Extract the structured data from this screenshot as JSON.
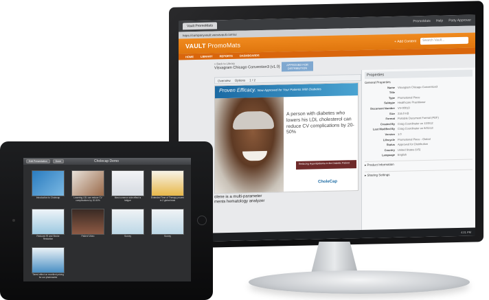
{
  "monitor": {
    "browser_tab": "Vault PromoMats",
    "browser_right": [
      "PromoMats",
      "Help",
      "Patty Approver"
    ],
    "url": "https://companyvault.veevavault.com/ui",
    "app_logo_bold": "VAULT",
    "app_logo_light": "PromoMats",
    "add_content": "+ Add Content",
    "search_placeholder": "Search Vault...",
    "nav": [
      "HOME",
      "LIBRARY",
      "REPORTS",
      "DASHBOARDS"
    ],
    "crumb": "« Back to Library",
    "doc_title": "Visvagram Chicago Convention3 (v1.0)",
    "approve_label": "APPROVED FOR DISTRIBUTION",
    "toolbar": [
      "Overview",
      "Options",
      "1 / 2"
    ],
    "slide": {
      "banner": "Proven Efficacy.",
      "banner_small": "Now Approved for Your Patients With Diabetes",
      "quote": "A person with diabetes who lowers his LDL cholesterol can reduce CV complications by 20-50%",
      "ad": "Reducing Hyperlipidemia in the Diabetic Patient",
      "logo": "CholeCap"
    },
    "footer_line1": "olene is a multi-parameter",
    "footer_line2": "ments hematology analyzer",
    "props": {
      "header": "Properties",
      "sub": "General Properties",
      "rows": [
        {
          "k": "Name",
          "v": "Visvagram Chicago Convention3"
        },
        {
          "k": "Title",
          "v": ""
        },
        {
          "k": "Type",
          "v": "Promotional Piece"
        },
        {
          "k": "Subtype",
          "v": "Healthcare Practitioner"
        },
        {
          "k": "Document Number",
          "v": "VV-00019"
        },
        {
          "k": "Size",
          "v": "216.0 KB"
        },
        {
          "k": "Format",
          "v": "Portable Document Format (PDF)"
        },
        {
          "k": "Created By",
          "v": "Craig Coordinator on 12/3/12"
        },
        {
          "k": "Last Modified By",
          "v": "Craig Coordinator on 6/21/13"
        },
        {
          "k": "Version",
          "v": "1.0"
        },
        {
          "k": "Lifecycle",
          "v": "Promotional Piece - Global"
        },
        {
          "k": "Status",
          "v": "Approved for Distribution"
        },
        {
          "k": "Country",
          "v": "United States (US)"
        },
        {
          "k": "Language",
          "v": "English"
        }
      ],
      "section1": "▸ Product Information",
      "section2": "▸ Sharing Settings"
    },
    "clock": "4:21 PM"
  },
  "ipad": {
    "btn_left": "Edit Presentation",
    "btn_right": "Done",
    "title": "Cholecap Demo",
    "tiles": [
      {
        "caption": "Introduction to Cholecap"
      },
      {
        "caption": "Lowering LDL can reduce CV complications by 20-50%"
      },
      {
        "caption": "Most common side effect is fatigue"
      },
      {
        "caption": "Extended Time of Therapy proven in 2 global trials"
      },
      {
        "caption": "Reduced RI and Stroke Reduction"
      },
      {
        "caption": "Patient Video"
      },
      {
        "caption": "Survey"
      },
      {
        "caption": "Survey"
      },
      {
        "caption": "Tiered effect on excellent pricing for our pharmacies"
      }
    ]
  },
  "colors": {
    "accent": "#f08a1e",
    "nav": "#d9660c",
    "slide_blue": "#1b6aa3"
  }
}
